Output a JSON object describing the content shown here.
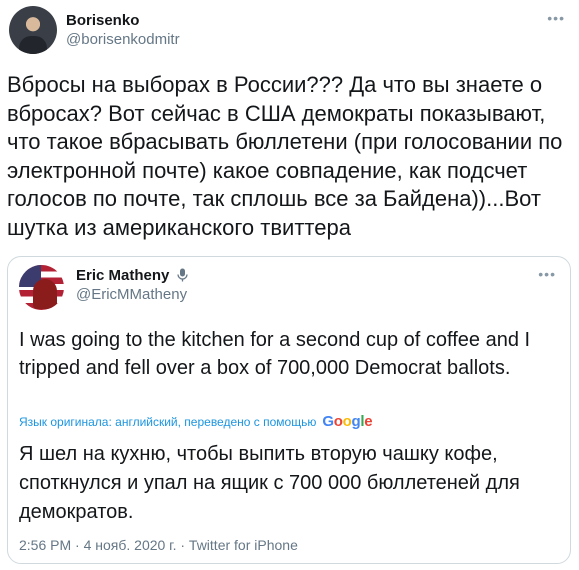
{
  "tweet": {
    "author_name": "Borisenko",
    "author_handle": "@borisenkodmitr",
    "text": "Вбросы на выборах в России??? Да что вы знаете о вбросах? Вот сейчас в США демократы показывают, что такое вбрасывать бюллетени (при голосовании по электронной почте) какое совпадение, как подсчет голосов по почте, так сплошь все за Байдена))...Вот шутка из американского твиттера",
    "more_icon": "more-horizontal-icon"
  },
  "quoted_tweet": {
    "author_name": "Eric Matheny",
    "author_handle": "@EricMMatheny",
    "text": "I was going to the kitchen for a second cup of coffee and I tripped and fell over a box of 700,000 Democrat ballots.",
    "translation_label": "Язык оригинала: английский, переведено с помощью",
    "translation_provider": "Google",
    "translation": "Я шел на кухню, чтобы выпить вторую чашку кофе, споткнулся и упал на ящик с 700 000 бюллетеней для демократов.",
    "meta": "2:56 PM · 4 нояб. 2020 г. · Twitter for iPhone",
    "badge_icon": "microphone-icon"
  },
  "colors": {
    "link": "#1b95e0",
    "secondary_text": "#657786",
    "border": "#cfd9de"
  }
}
